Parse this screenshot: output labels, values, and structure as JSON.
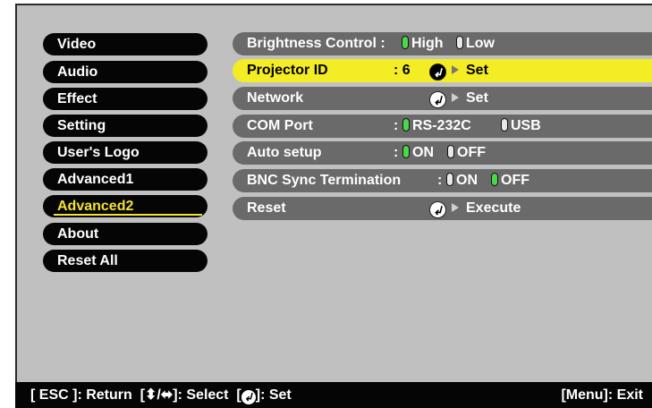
{
  "sidebar": {
    "items": [
      {
        "label": "Video"
      },
      {
        "label": "Audio"
      },
      {
        "label": "Effect"
      },
      {
        "label": "Setting"
      },
      {
        "label": "User's Logo"
      },
      {
        "label": "Advanced1"
      },
      {
        "label": "Advanced2",
        "selected": true
      },
      {
        "label": "About"
      },
      {
        "label": "Reset All"
      }
    ]
  },
  "settings": {
    "brightness": {
      "label": "Brightness Control",
      "sep": ":",
      "options": [
        "High",
        "Low"
      ],
      "selected": "High"
    },
    "projector_id": {
      "label": "Projector ID",
      "sep": ":",
      "value": "6",
      "action": "Set",
      "highlighted": true
    },
    "network": {
      "label": "Network",
      "action": "Set"
    },
    "com_port": {
      "label": "COM Port",
      "sep": ":",
      "options": [
        "RS-232C",
        "USB"
      ],
      "selected": "RS-232C"
    },
    "auto_setup": {
      "label": "Auto setup",
      "sep": ":",
      "options": [
        "ON",
        "OFF"
      ],
      "selected": "ON"
    },
    "bnc": {
      "label": "BNC Sync Termination",
      "sep": ":",
      "options": [
        "ON",
        "OFF"
      ],
      "selected": "OFF"
    },
    "reset": {
      "label": "Reset",
      "action": "Execute"
    }
  },
  "footer": {
    "esc": "[ ESC ]: Return",
    "select_prefix": "[",
    "select_suffix": "]: Select",
    "set_prefix": "[",
    "set_suffix": "]: Set",
    "menu_exit": "[Menu]: Exit"
  },
  "icons": {
    "enter": "enter-icon",
    "arrow": "arrow-right-icon",
    "updown": "updown-arrows-icon",
    "leftright": "leftright-arrows-icon"
  },
  "colors": {
    "highlight": "#f4ec24",
    "selected_text": "#f4e42c",
    "active_option": "#4ad84a",
    "row_bg": "#6a6a6a",
    "bg": "#c0c0c0"
  }
}
